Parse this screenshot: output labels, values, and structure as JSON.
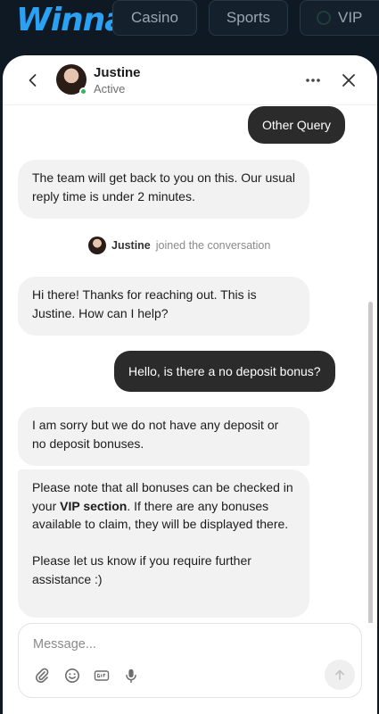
{
  "site": {
    "logo": "Winna",
    "nav": [
      {
        "label": "Casino"
      },
      {
        "label": "Sports"
      },
      {
        "label": "VIP"
      }
    ]
  },
  "chat": {
    "agent": {
      "name": "Justine",
      "status": "Active"
    },
    "messages": [
      {
        "from": "user",
        "text": "Other Query"
      },
      {
        "from": "bot",
        "text": "The team will get back to you on this. Our usual reply time is under 2 minutes."
      },
      {
        "from": "system",
        "name": "Justine",
        "text": "joined the conversation"
      },
      {
        "from": "agent",
        "text": "Hi there! Thanks for reaching out. This is Justine. How can I help?"
      },
      {
        "from": "user",
        "text": "Hello, is there a no deposit bonus?"
      },
      {
        "from": "agent",
        "text": "I am sorry but we do not have any deposit or no deposit bonuses."
      },
      {
        "from": "agent",
        "text_before": "Please note that all bonuses can be checked in your ",
        "text_bold": "VIP section",
        "text_after": ". If there are any bonuses available to claim, they will be displayed there.\n\nPlease let us know if you require further assistance :)"
      }
    ],
    "composer": {
      "placeholder": "Message..."
    }
  },
  "colors": {
    "accent": "#2aa1f2",
    "user_bubble": "#2b2b2b",
    "agent_bubble": "#f2f2f2",
    "online": "#2eb85c"
  },
  "icons": [
    "back-chevron-icon",
    "more-icon",
    "close-icon",
    "attach-icon",
    "emoji-icon",
    "gif-icon",
    "mic-icon",
    "send-arrow-icon"
  ]
}
